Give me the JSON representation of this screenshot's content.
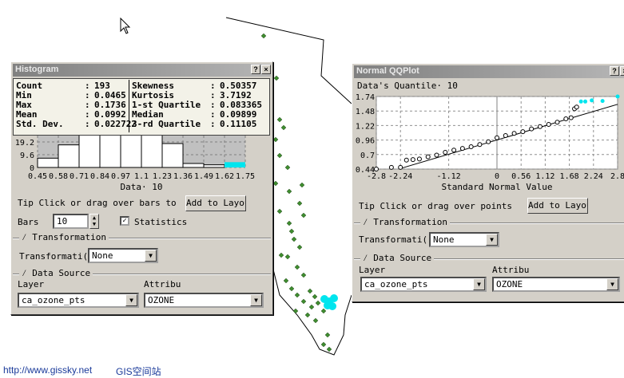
{
  "footer": {
    "url": "http://www.gissky.net",
    "site": "GIS空间站"
  },
  "colors": {
    "point": "#3f8f2f",
    "selected": "#00e5ee",
    "title_bar": "#8a8a8a"
  },
  "histogram": {
    "title": "Histogram",
    "help": "?",
    "close": "×",
    "stats": {
      "left": [
        [
          "Count",
          ":",
          "193"
        ],
        [
          "Min",
          ":",
          "0.0465"
        ],
        [
          "Max",
          ":",
          "0.1736"
        ],
        [
          "Mean",
          ":",
          "0.0992"
        ],
        [
          "Std. Dev.",
          ":",
          "0.022722"
        ]
      ],
      "right": [
        [
          "Skewness",
          ":",
          "0.50357"
        ],
        [
          "Kurtosis",
          ":",
          "3.7192"
        ],
        [
          "1-st Quartile",
          ":",
          "0.083365"
        ],
        [
          "Median",
          ":",
          "0.09899"
        ],
        [
          "3-rd Quartile",
          ":",
          "0.11105"
        ]
      ]
    },
    "tip": "Tip  Click or drag over bars to",
    "add_to_layout": "Add to Layout",
    "bars_label": "Bars",
    "bars_value": "10",
    "statistics_label": "Statistics",
    "statistics_checked": true,
    "transformation_group": "Transformation",
    "transformation_label": "Transformati(",
    "transformation_value": "None",
    "data_source_group": "Data Source",
    "layer_label": "Layer",
    "layer_value": "ca_ozone_pts",
    "attribute_label": "Attribu",
    "attribute_value": "OZONE"
  },
  "qqplot": {
    "title": "Normal QQPlot",
    "help": "?",
    "close": "×",
    "tip": "Tip  Click or drag over points",
    "add_to_layout": "Add to Layout",
    "transformation_group": "Transformation",
    "transformation_label": "Transformati(",
    "transformation_value": "None",
    "data_source_group": "Data Source",
    "layer_label": "Layer",
    "layer_value": "ca_ozone_pts",
    "attribute_label": "Attribu",
    "attribute_value": "OZONE"
  },
  "chart_data": [
    {
      "type": "bar",
      "title": "Histogram",
      "xlabel": "Data· 10",
      "ylabel": "",
      "x_ticks": [
        "0.45",
        "0.58",
        "0.71",
        "0.84",
        "0.97",
        "1.1",
        "1.23",
        "1.36",
        "1.49",
        "1.62",
        "1.75"
      ],
      "y_ticks": [
        "0",
        "9.6",
        "19.2"
      ],
      "ylim": [
        0,
        40
      ],
      "values": [
        7,
        17,
        35,
        37,
        38,
        32,
        18,
        3,
        2,
        4
      ],
      "selected_bins": [
        9
      ]
    },
    {
      "type": "scatter",
      "title": "Data's Quantile· 10",
      "xlabel": "Standard Normal Value",
      "x_ticks": [
        "-2.8",
        "-2.24",
        "-1.12",
        "0",
        "0.56",
        "1.12",
        "1.68",
        "2.24",
        "2.8"
      ],
      "y_ticks": [
        "0.44",
        "0.7",
        "0.96",
        "1.22",
        "1.48",
        "1.74"
      ],
      "xlim": [
        -2.8,
        2.8
      ],
      "ylim": [
        0.44,
        1.74
      ],
      "reference_line": [
        [
          -2.24,
          0.45
        ],
        [
          2.8,
          1.6
        ]
      ],
      "points": [
        [
          -2.8,
          0.44
        ],
        [
          -2.45,
          0.47
        ],
        [
          -2.24,
          0.47
        ],
        [
          -2.1,
          0.6
        ],
        [
          -1.95,
          0.61
        ],
        [
          -1.8,
          0.62
        ],
        [
          -1.6,
          0.66
        ],
        [
          -1.4,
          0.69
        ],
        [
          -1.2,
          0.74
        ],
        [
          -1.0,
          0.78
        ],
        [
          -0.8,
          0.81
        ],
        [
          -0.6,
          0.84
        ],
        [
          -0.4,
          0.88
        ],
        [
          -0.2,
          0.93
        ],
        [
          0,
          1.0
        ],
        [
          0.2,
          1.04
        ],
        [
          0.4,
          1.08
        ],
        [
          0.6,
          1.11
        ],
        [
          0.8,
          1.16
        ],
        [
          1.0,
          1.2
        ],
        [
          1.2,
          1.24
        ],
        [
          1.4,
          1.28
        ],
        [
          1.6,
          1.34
        ],
        [
          1.72,
          1.36
        ],
        [
          1.8,
          1.52
        ],
        [
          1.85,
          1.55
        ]
      ],
      "selected_points": [
        [
          1.95,
          1.65
        ],
        [
          2.05,
          1.65
        ],
        [
          2.2,
          1.67
        ],
        [
          2.45,
          1.66
        ],
        [
          2.8,
          1.74
        ]
      ]
    }
  ]
}
